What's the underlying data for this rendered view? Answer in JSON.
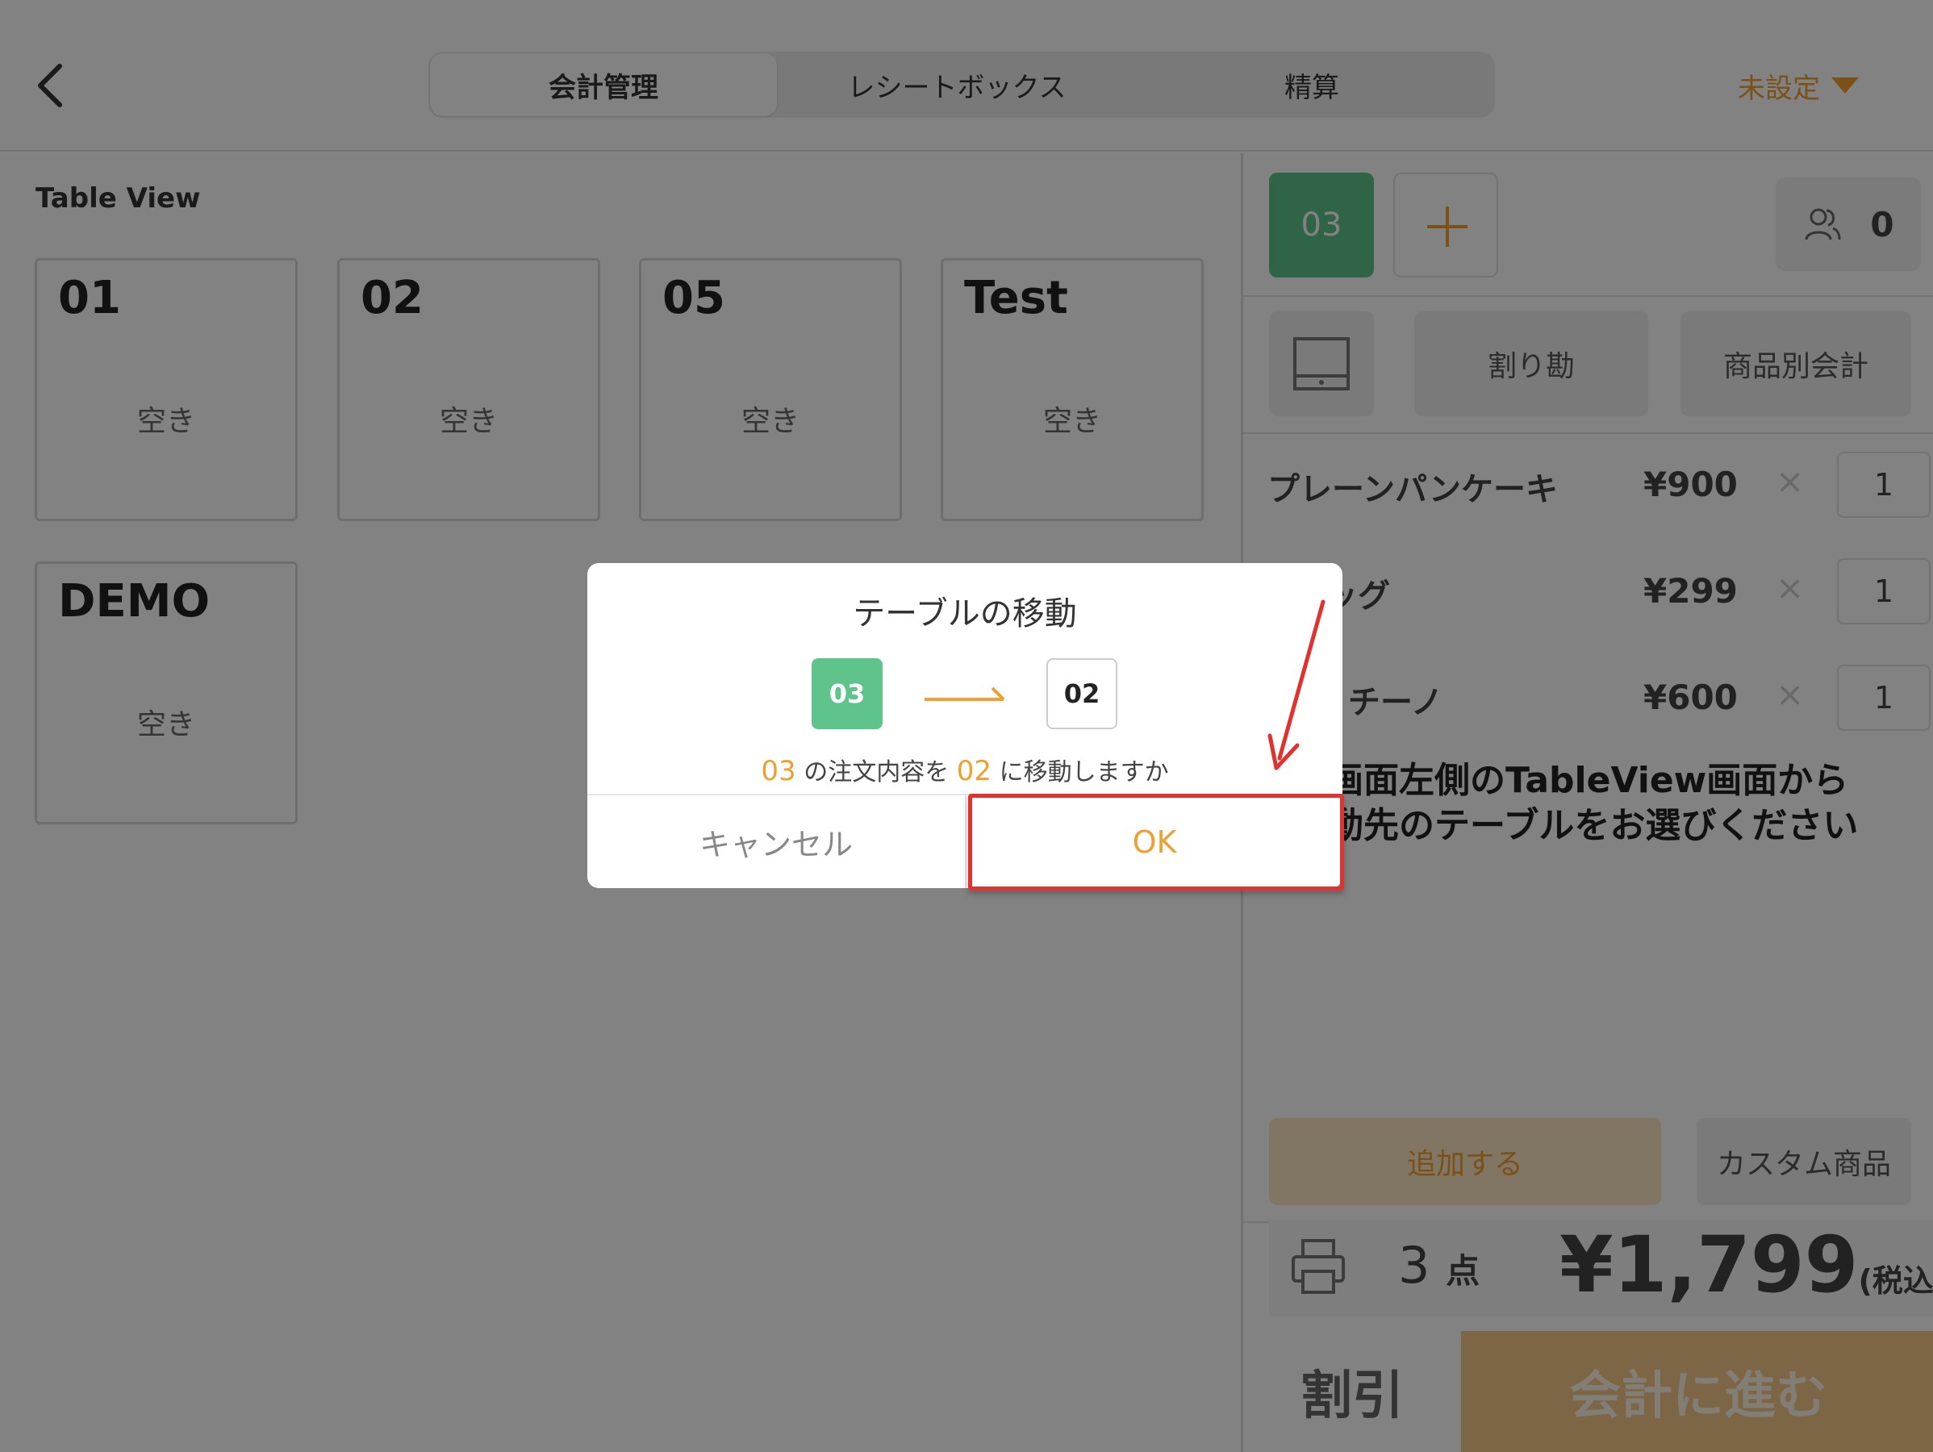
{
  "header": {
    "tabs": [
      "会計管理",
      "レシートボックス",
      "精算"
    ],
    "active_tab": 0,
    "user_select_label": "未設定"
  },
  "left_panel": {
    "title": "Table View",
    "tables": [
      {
        "name": "01",
        "status": "空き"
      },
      {
        "name": "02",
        "status": "空き"
      },
      {
        "name": "05",
        "status": "空き"
      },
      {
        "name": "Test",
        "status": "空き"
      },
      {
        "name": "DEMO",
        "status": "空き"
      }
    ]
  },
  "right_panel": {
    "current_table": "03",
    "guest_count": "0",
    "split_bill_label": "割り勘",
    "per_item_label": "商品別会計",
    "items": [
      {
        "name": "プレーンパンケーキ",
        "price": "¥900",
        "multiply": "×",
        "qty": "1"
      },
      {
        "name": "ッグ",
        "price": "¥299",
        "multiply": "×",
        "qty": "1"
      },
      {
        "name": "チーノ",
        "price": "¥600",
        "multiply": "×",
        "qty": "1"
      }
    ],
    "hint_line1": "画面左側のTableView画面から",
    "hint_line2": "動先のテーブルをお選びください",
    "add_label": "追加する",
    "custom_label": "カスタム商品",
    "count": "3",
    "count_unit": "点",
    "total": "¥1,799",
    "tax_note": "(税込み)",
    "discount_label": "割引",
    "checkout_label": "会計に進む"
  },
  "modal": {
    "title": "テーブルの移動",
    "from_table": "03",
    "to_table": "02",
    "message_from": "03",
    "message_part1": "の注文内容を",
    "message_to": "02",
    "message_part2": "に移動しますか",
    "cancel_label": "キャンセル",
    "ok_label": "OK"
  },
  "colors": {
    "accent": "#f0a030",
    "table_green": "#5ec48c",
    "annotation_red": "#e0322f"
  },
  "icons": [
    "back-chevron-icon",
    "dropdown-triangle-icon",
    "plus-icon",
    "guests-icon",
    "cash-drawer-icon",
    "printer-icon",
    "arrow-right-icon"
  ]
}
